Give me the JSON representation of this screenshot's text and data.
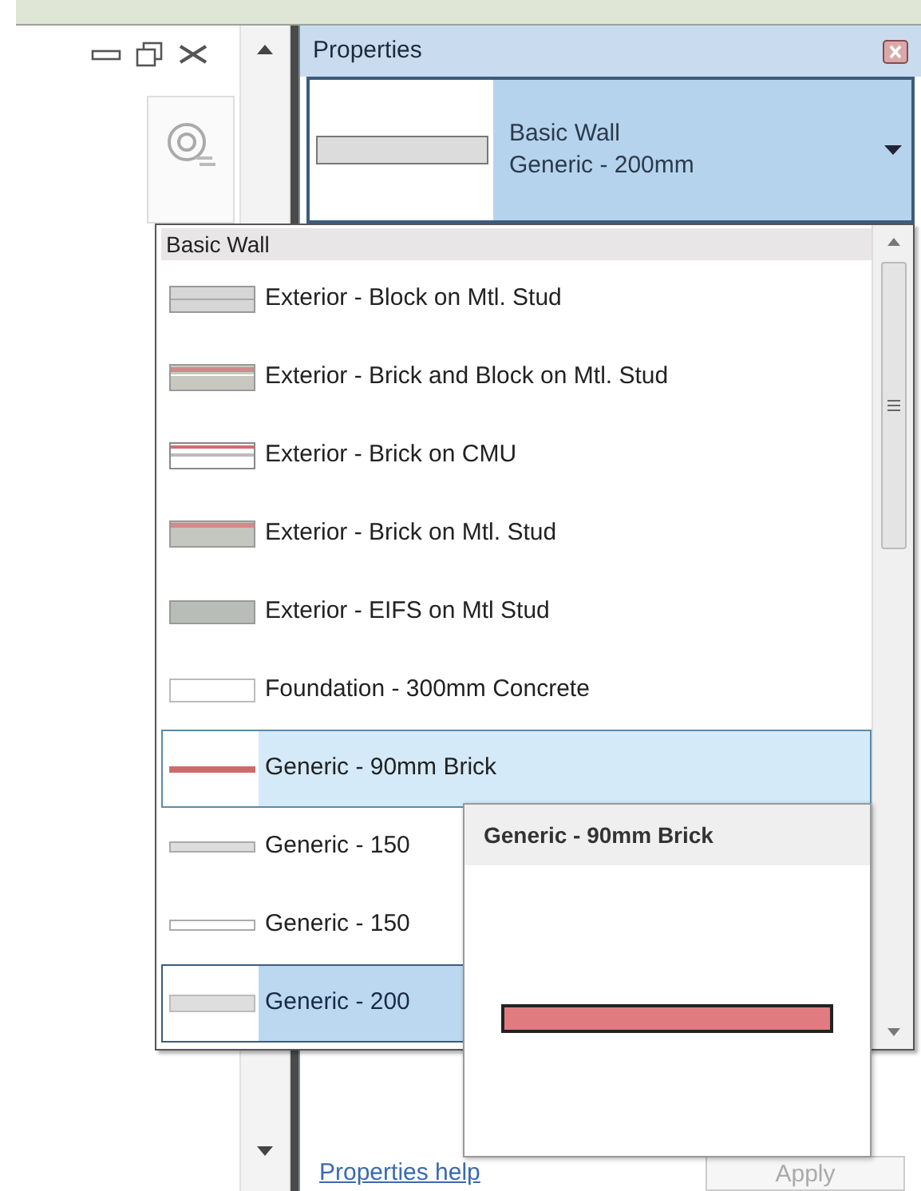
{
  "properties_panel": {
    "title": "Properties",
    "type_selector": {
      "family": "Basic Wall",
      "type": "Generic - 200mm"
    },
    "help_link": "Properties help",
    "apply_button": {
      "label": "Apply",
      "disabled": true
    }
  },
  "type_dropdown": {
    "group": "Basic Wall",
    "items": [
      {
        "label": "Exterior - Block on Mtl. Stud",
        "kind": "block",
        "hovered": false,
        "selected": false
      },
      {
        "label": "Exterior - Brick and Block on Mtl. Stud",
        "kind": "brickblock",
        "hovered": false,
        "selected": false
      },
      {
        "label": "Exterior - Brick on CMU",
        "kind": "brickcmu",
        "hovered": false,
        "selected": false
      },
      {
        "label": "Exterior - Brick on Mtl. Stud",
        "kind": "brickstud",
        "hovered": false,
        "selected": false
      },
      {
        "label": "Exterior - EIFS on Mtl Stud",
        "kind": "eifs",
        "hovered": false,
        "selected": false
      },
      {
        "label": "Foundation - 300mm Concrete",
        "kind": "foundation",
        "hovered": false,
        "selected": false
      },
      {
        "label": "Generic - 90mm Brick",
        "kind": "brickline",
        "hovered": true,
        "selected": false
      },
      {
        "label": "Generic - 150",
        "kind": "thingray",
        "hovered": false,
        "selected": false
      },
      {
        "label": "Generic - 150",
        "kind": "thinwhite",
        "hovered": false,
        "selected": false
      },
      {
        "label": "Generic - 200",
        "kind": "generic",
        "hovered": false,
        "selected": true
      }
    ]
  },
  "tooltip": {
    "title": "Generic - 90mm Brick"
  }
}
